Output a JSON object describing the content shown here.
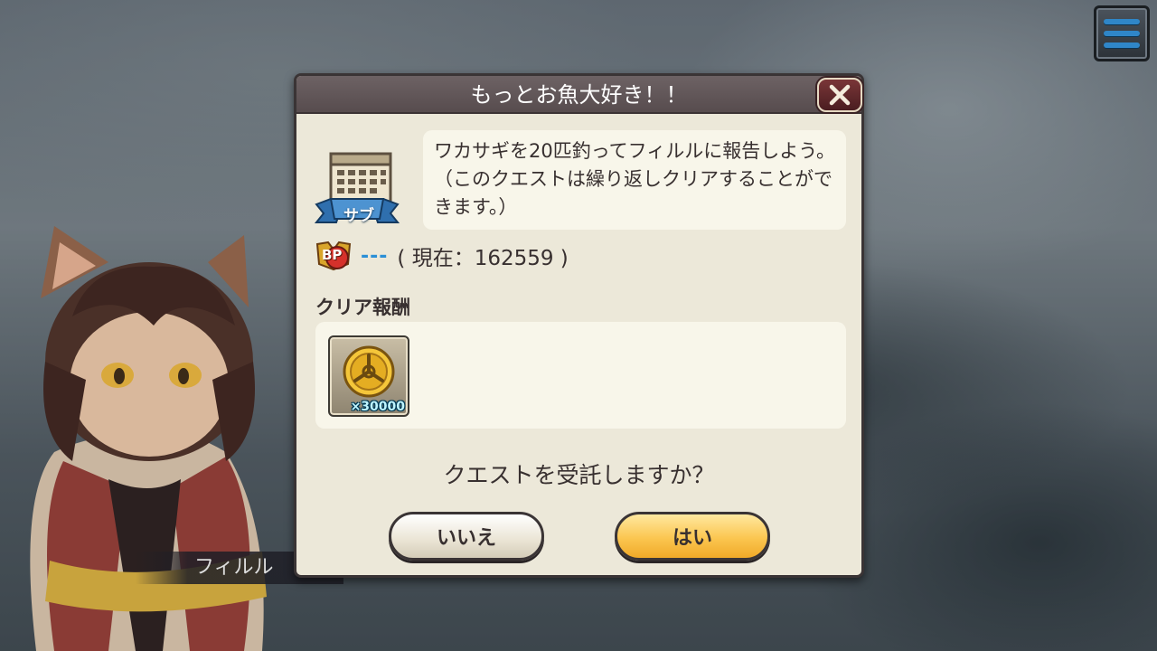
{
  "dialog": {
    "title": "もっとお魚大好き！！",
    "description": "ワカサギを20匹釣ってフィルルに報告しよう。（このクエストは繰り返しクリアすることができます。）",
    "quest_type_label": "サブ",
    "bp_label": "BP",
    "bp_value": "---",
    "bp_current": "( 現在：162559 )",
    "reward_title": "クリア報酬",
    "reward_quantity": "×30000",
    "question": "クエストを受託しますか？",
    "no_label": "いいえ",
    "yes_label": "はい"
  },
  "character": {
    "name": "フィルル"
  },
  "colors": {
    "bp_dash": "#2b8fd6",
    "yes_button": "#fbc650",
    "header": "#574c4e"
  },
  "icons": [
    "menu-icon",
    "close-icon",
    "calendar-icon",
    "coin-icon",
    "bp-icon"
  ]
}
